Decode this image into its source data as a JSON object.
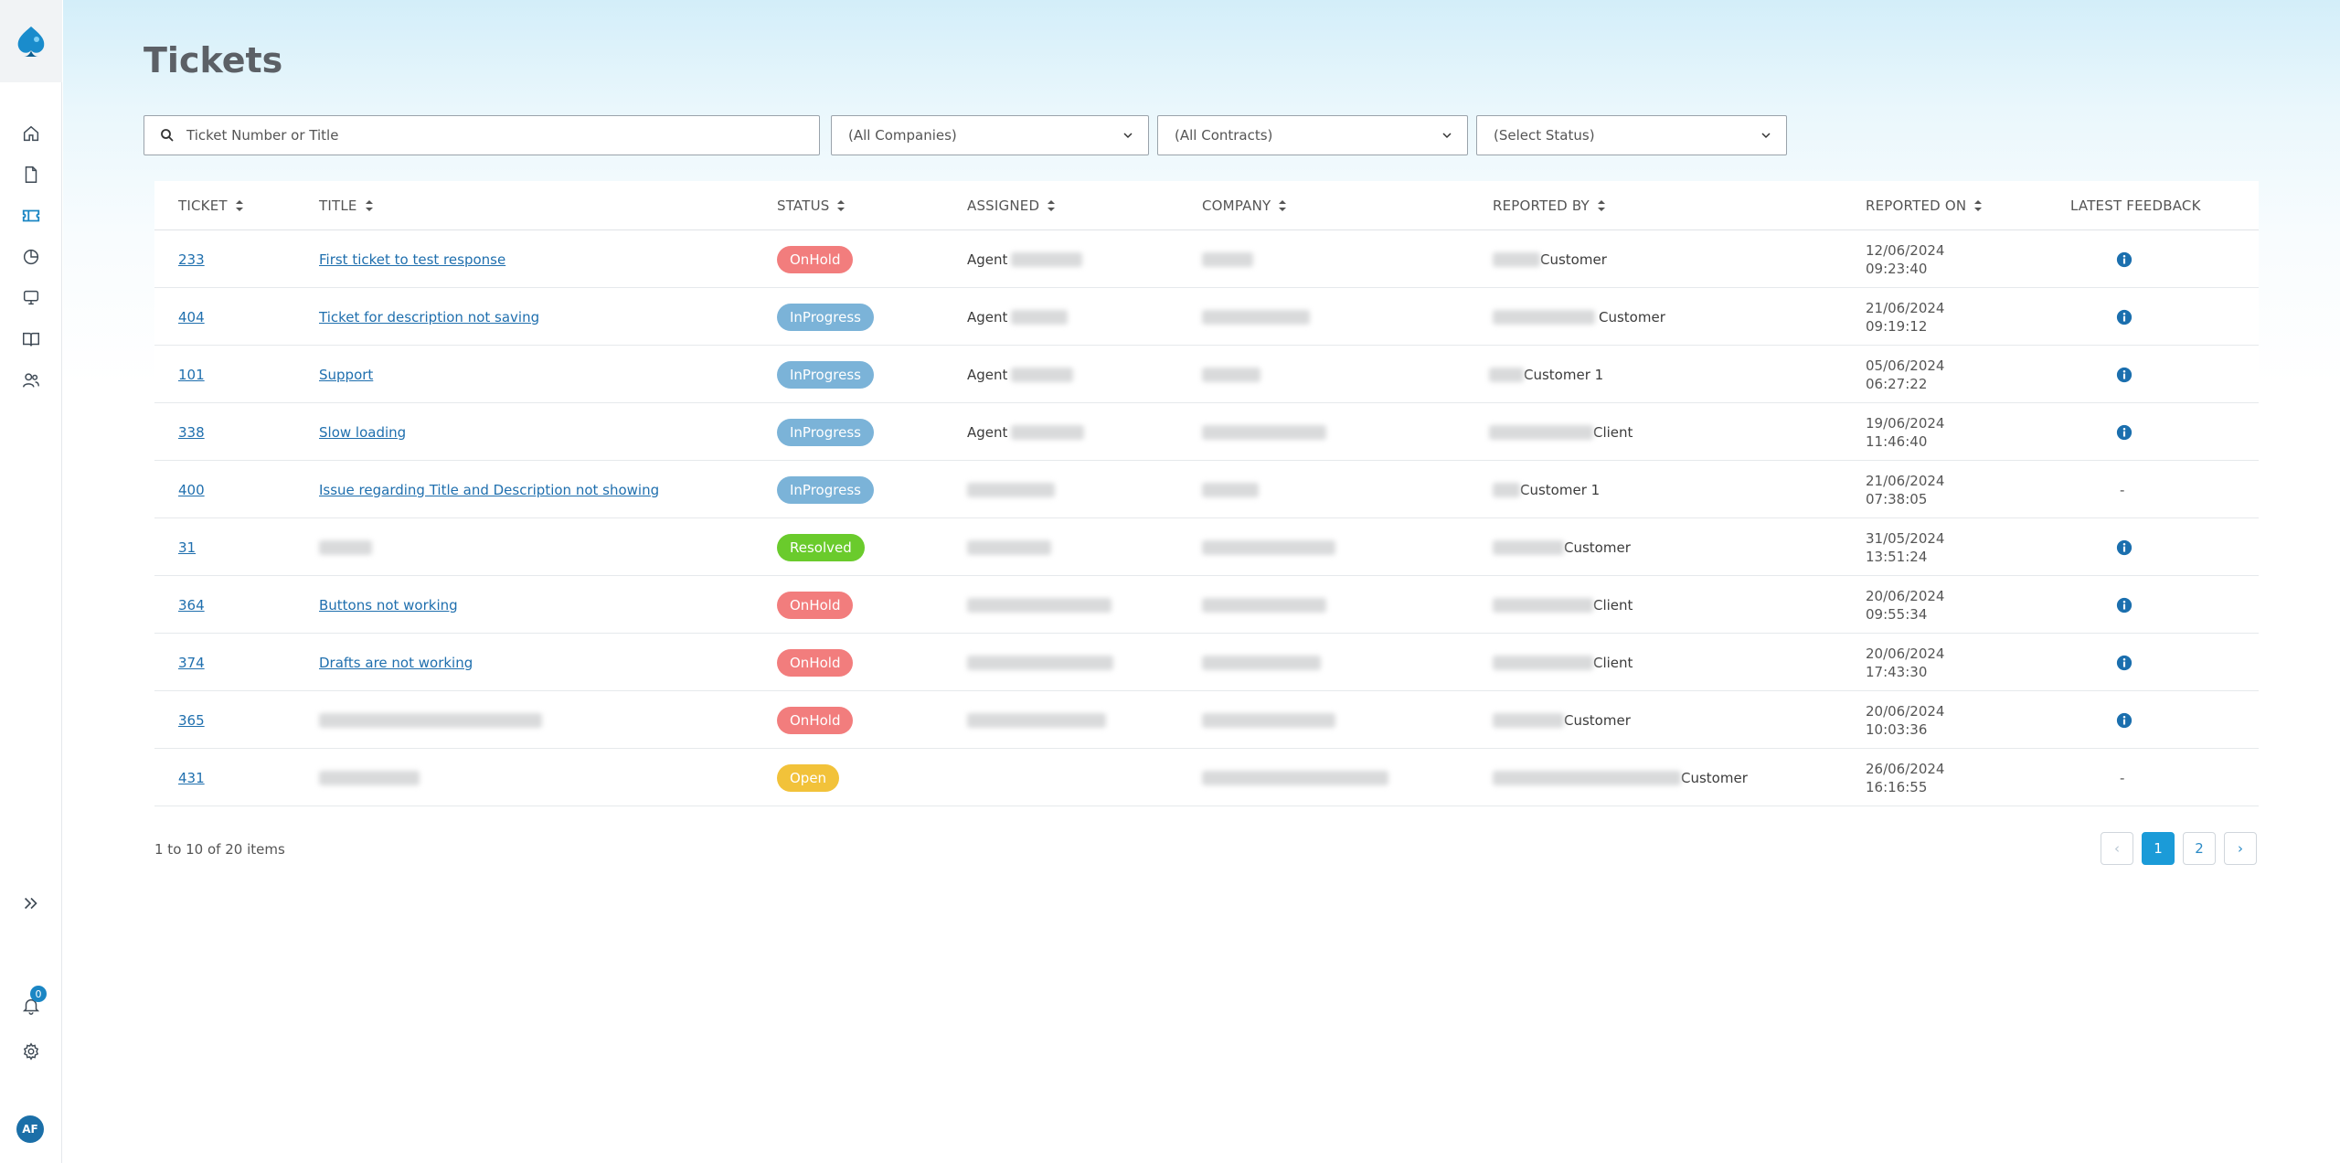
{
  "page": {
    "title": "Tickets"
  },
  "filters": {
    "search_placeholder": "Ticket Number or Title",
    "company_select": "(All Companies)",
    "contract_select": "(All Contracts)",
    "status_select": "(Select Status)"
  },
  "table": {
    "headers": {
      "ticket": "TICKET",
      "title": "TITLE",
      "status": "STATUS",
      "assigned": "ASSIGNED",
      "company": "COMPANY",
      "reported_by": "REPORTED BY",
      "reported_on": "REPORTED ON",
      "latest_feedback": "LATEST FEEDBACK"
    },
    "rows": [
      {
        "ticket": "233",
        "title": "First ticket to test response",
        "status": "OnHold",
        "assigned": "Agent",
        "reported_by": "Customer",
        "date": "12/06/2024",
        "time": "09:23:40",
        "feedback": "info"
      },
      {
        "ticket": "404",
        "title": "Ticket for description not saving",
        "status": "InProgress",
        "assigned": "Agent",
        "reported_by": "Customer",
        "date": "21/06/2024",
        "time": "09:19:12",
        "feedback": "info"
      },
      {
        "ticket": "101",
        "title": "Support",
        "status": "InProgress",
        "assigned": "Agent",
        "reported_by": "Customer 1",
        "date": "05/06/2024",
        "time": "06:27:22",
        "feedback": "info"
      },
      {
        "ticket": "338",
        "title": "Slow loading",
        "status": "InProgress",
        "assigned": "Agent",
        "reported_by": "Client",
        "date": "19/06/2024",
        "time": "11:46:40",
        "feedback": "info"
      },
      {
        "ticket": "400",
        "title": "Issue regarding Title and Description not showing",
        "status": "InProgress",
        "assigned": "",
        "reported_by": "Customer 1",
        "date": "21/06/2024",
        "time": "07:38:05",
        "feedback": "-"
      },
      {
        "ticket": "31",
        "title": "",
        "status": "Resolved",
        "assigned": "",
        "reported_by": "Customer",
        "date": "31/05/2024",
        "time": "13:51:24",
        "feedback": "info"
      },
      {
        "ticket": "364",
        "title": "Buttons not working",
        "status": "OnHold",
        "assigned": "",
        "reported_by": "Client",
        "date": "20/06/2024",
        "time": "09:55:34",
        "feedback": "info"
      },
      {
        "ticket": "374",
        "title": "Drafts are not working",
        "status": "OnHold",
        "assigned": "",
        "reported_by": "Client",
        "date": "20/06/2024",
        "time": "17:43:30",
        "feedback": "info"
      },
      {
        "ticket": "365",
        "title": "",
        "status": "OnHold",
        "assigned": "",
        "reported_by": "Customer",
        "date": "20/06/2024",
        "time": "10:03:36",
        "feedback": "info"
      },
      {
        "ticket": "431",
        "title": "",
        "status": "Open",
        "assigned": "",
        "reported_by": "Customer",
        "date": "26/06/2024",
        "time": "16:16:55",
        "feedback": "-"
      }
    ]
  },
  "status_colors": {
    "OnHold": "#f27d7d",
    "InProgress": "#7bb3d8",
    "Resolved": "#6acb2c",
    "Open": "#f2c23a"
  },
  "pagination": {
    "summary": "1 to 10 of 20 items",
    "prev": "‹",
    "pages": [
      "1",
      "2"
    ],
    "next": "›",
    "current": "1"
  },
  "sidebar": {
    "notification_count": "0",
    "avatar_initials": "AF",
    "icons": [
      "home-icon",
      "document-icon",
      "ticket-icon",
      "chart-pie-icon",
      "monitor-icon",
      "book-icon",
      "users-icon",
      "expand-icon",
      "bell-icon",
      "gear-icon"
    ]
  }
}
